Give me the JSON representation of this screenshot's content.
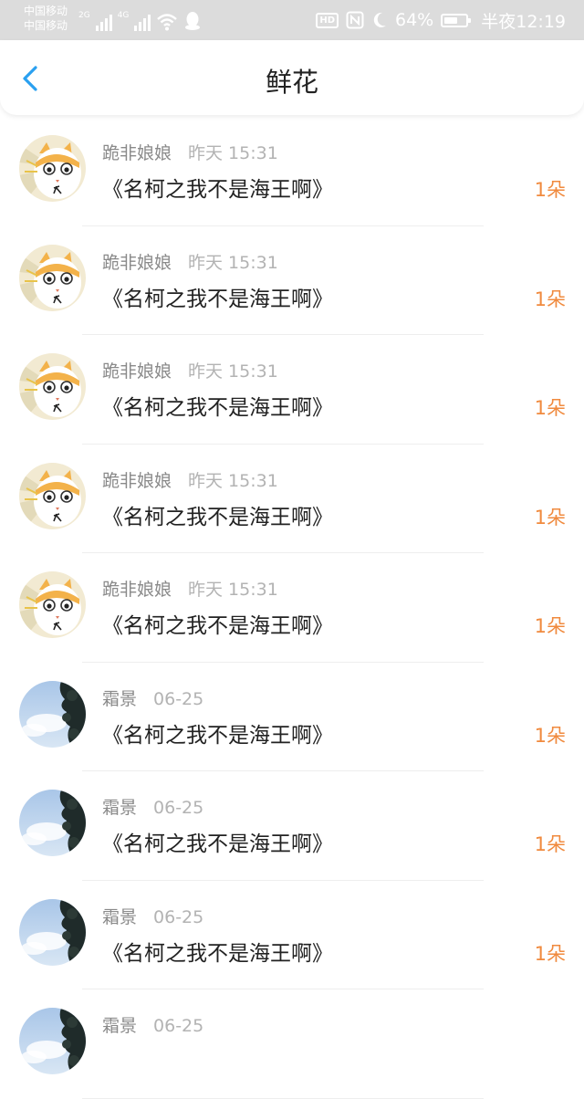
{
  "status_bar": {
    "carrier_1": "中国移动",
    "carrier_2": "中国移动",
    "net_1": "2G",
    "net_2": "4G",
    "battery": "64%",
    "battery_level": 0.64,
    "time": "半夜12:19",
    "icons": [
      "signal-icon",
      "wifi-icon",
      "qq-icon",
      "hd-icon",
      "nfc-icon",
      "moon-icon",
      "battery-icon"
    ]
  },
  "header": {
    "title": "鲜花",
    "back_icon": "chevron-left-icon",
    "accent": "#2aa0f0"
  },
  "items": [
    {
      "nickname": "跪非娘娘",
      "time": "昨天 15:31",
      "book": "《名柯之我不是海王啊》",
      "count": "1朵",
      "avatar": "cat"
    },
    {
      "nickname": "跪非娘娘",
      "time": "昨天 15:31",
      "book": "《名柯之我不是海王啊》",
      "count": "1朵",
      "avatar": "cat"
    },
    {
      "nickname": "跪非娘娘",
      "time": "昨天 15:31",
      "book": "《名柯之我不是海王啊》",
      "count": "1朵",
      "avatar": "cat"
    },
    {
      "nickname": "跪非娘娘",
      "time": "昨天 15:31",
      "book": "《名柯之我不是海王啊》",
      "count": "1朵",
      "avatar": "cat"
    },
    {
      "nickname": "跪非娘娘",
      "time": "昨天 15:31",
      "book": "《名柯之我不是海王啊》",
      "count": "1朵",
      "avatar": "cat"
    },
    {
      "nickname": "霜景",
      "time": "06-25",
      "book": "《名柯之我不是海王啊》",
      "count": "1朵",
      "avatar": "sky"
    },
    {
      "nickname": "霜景",
      "time": "06-25",
      "book": "《名柯之我不是海王啊》",
      "count": "1朵",
      "avatar": "sky"
    },
    {
      "nickname": "霜景",
      "time": "06-25",
      "book": "《名柯之我不是海王啊》",
      "count": "1朵",
      "avatar": "sky"
    },
    {
      "nickname": "霜景",
      "time": "06-25",
      "book": "",
      "count": "",
      "avatar": "sky"
    }
  ],
  "colors": {
    "count": "#f08a3e",
    "status_bar": "#dcdcdc"
  }
}
